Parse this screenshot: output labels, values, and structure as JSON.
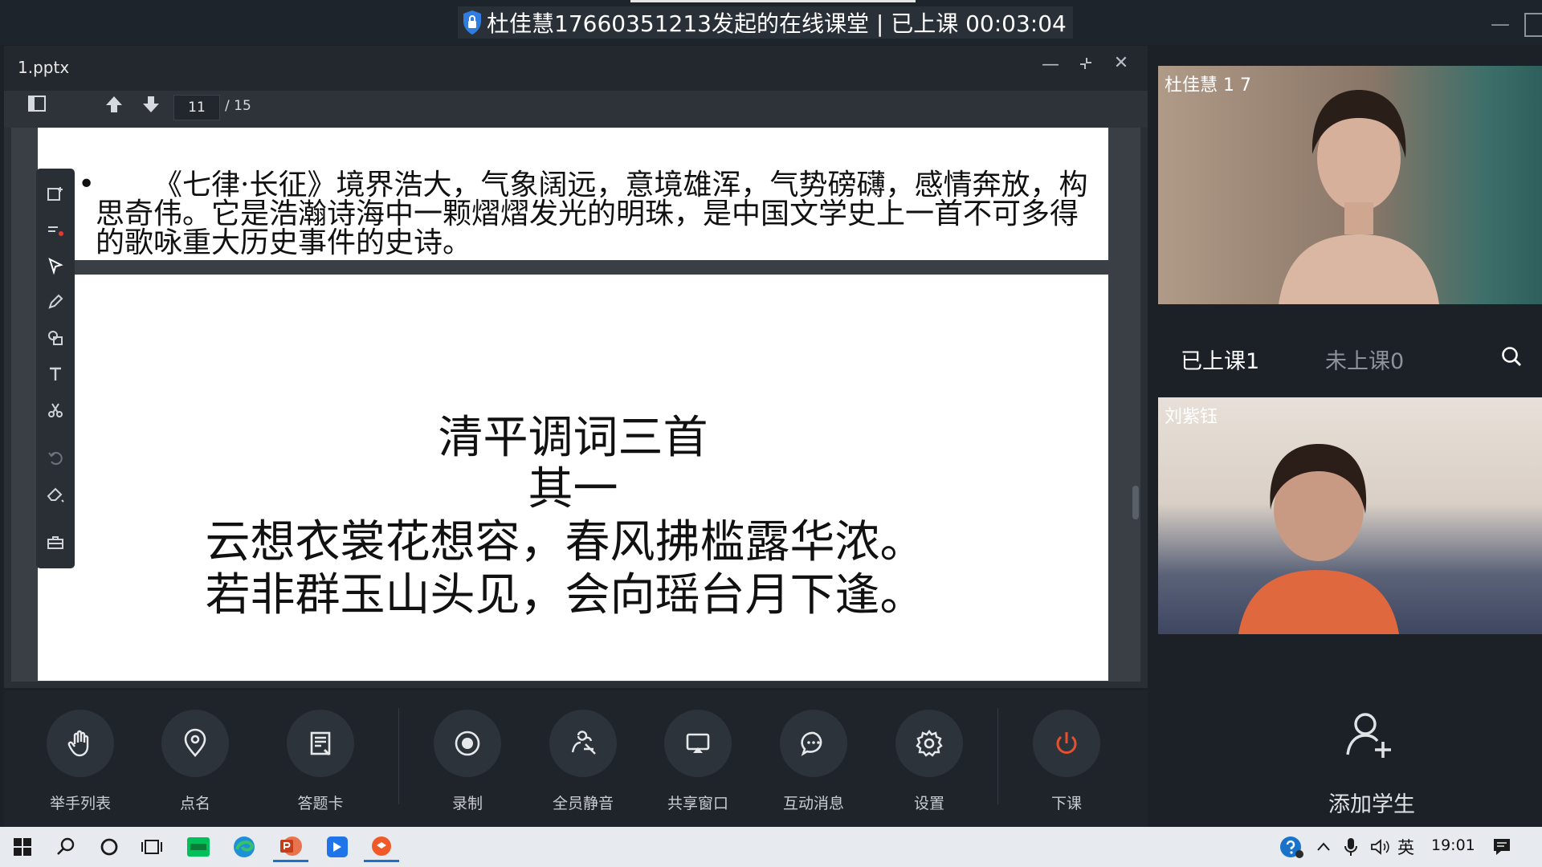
{
  "window": {
    "title": "杜佳慧17660351213发起的在线课堂 | 已上课 00:03:04"
  },
  "document": {
    "filename": "1.pptx",
    "current_page": "11",
    "total_pages": "/ 15"
  },
  "slide_prev": {
    "text": "《七律·长征》境界浩大，气象阔远，意境雄浑，气势磅礴，感情奔放，构思奇伟。它是浩瀚诗海中一颗熠熠发光的明珠，是中国文学史上一首不可多得的歌咏重大历史事件的史诗。"
  },
  "slide_current": {
    "title": "清平调词三首",
    "subtitle": "其一",
    "line1": "云想衣裳花想容，春风拂槛露华浓。",
    "line2": "若非群玉山头见，会向瑶台月下逢。"
  },
  "controls": [
    {
      "label": "举手列表",
      "icon": "hand-raise-icon"
    },
    {
      "label": "点名",
      "icon": "location-pin-icon"
    },
    {
      "label": "答题卡",
      "icon": "answer-card-icon"
    },
    {
      "label": "录制",
      "icon": "record-icon"
    },
    {
      "label": "全员静音",
      "icon": "mute-all-icon"
    },
    {
      "label": "共享窗口",
      "icon": "share-screen-icon"
    },
    {
      "label": "互动消息",
      "icon": "chat-bubble-icon"
    },
    {
      "label": "设置",
      "icon": "gear-icon"
    },
    {
      "label": "下课",
      "icon": "power-icon"
    }
  ],
  "participants": {
    "teacher_name": "杜佳慧 1 7",
    "tab_in_class": "已上课1",
    "tab_not_in_class": "未上课0",
    "student_name": "刘紫钰",
    "add_student": "添加学生"
  },
  "taskbar": {
    "lang": "英",
    "time": "19:01"
  },
  "colors": {
    "accent_power": "#e5502f",
    "panel_bg": "#1c2128"
  }
}
